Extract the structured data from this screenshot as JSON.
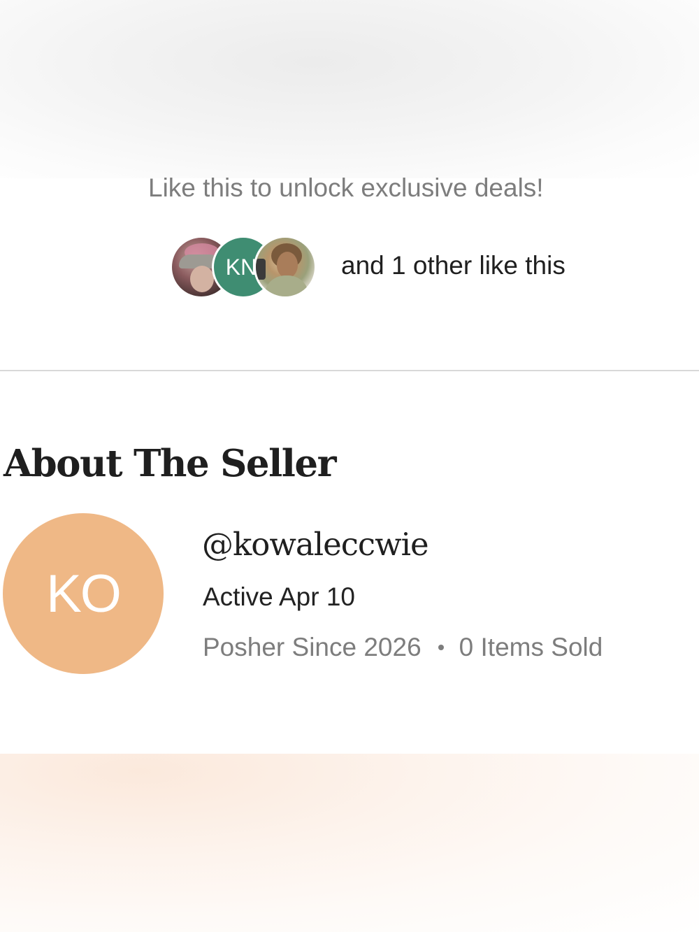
{
  "promo": {
    "text": "Like this to unlock exclusive deals!"
  },
  "likes": {
    "avatars": [
      {
        "name": "liker-photo-1"
      },
      {
        "initials": "KN"
      },
      {
        "name": "liker-photo-3"
      }
    ],
    "summary": "and 1 other like this"
  },
  "about_seller": {
    "title": "About The Seller",
    "avatar_initials": "KO",
    "avatar_color": "#efb886",
    "username": "@kowaleccwie",
    "active": "Active Apr 10",
    "posher_since": "Posher Since 2026",
    "items_sold": "0 Items Sold"
  },
  "colors": {
    "liker_initials_bg": "#3f8d72",
    "secondary_text": "#7d7d7d",
    "primary_text": "#1f1f1f"
  }
}
